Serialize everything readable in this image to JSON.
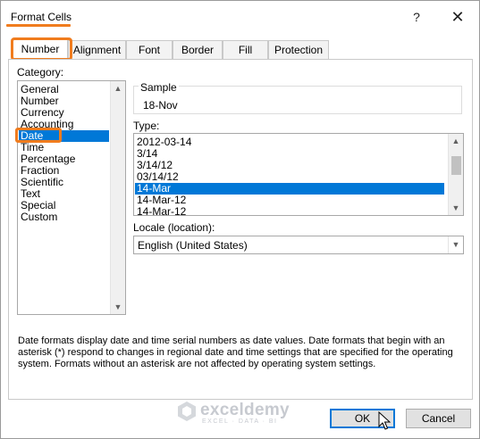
{
  "window": {
    "title": "Format Cells",
    "help_label": "?",
    "close_label": "✕"
  },
  "tabs": [
    {
      "label": "Number",
      "active": true
    },
    {
      "label": "Alignment",
      "active": false
    },
    {
      "label": "Font",
      "active": false
    },
    {
      "label": "Border",
      "active": false
    },
    {
      "label": "Fill",
      "active": false
    },
    {
      "label": "Protection",
      "active": false
    }
  ],
  "category": {
    "label": "Category:",
    "items": [
      "General",
      "Number",
      "Currency",
      "Accounting",
      "Date",
      "Time",
      "Percentage",
      "Fraction",
      "Scientific",
      "Text",
      "Special",
      "Custom"
    ],
    "selected": "Date"
  },
  "sample": {
    "label": "Sample",
    "value": "18-Nov"
  },
  "type": {
    "label": "Type:",
    "items": [
      "2012-03-14",
      "3/14",
      "3/14/12",
      "03/14/12",
      "14-Mar",
      "14-Mar-12",
      "14-Mar-12"
    ],
    "selected": "14-Mar"
  },
  "locale": {
    "label": "Locale (location):",
    "value": "English (United States)"
  },
  "description": "Date formats display date and time serial numbers as date values.  Date formats that begin with an asterisk (*) respond to changes in regional date and time settings that are specified for the operating system. Formats without an asterisk are not affected by operating system settings.",
  "watermark": {
    "name": "exceldemy",
    "tagline": "EXCEL · DATA · BI"
  },
  "buttons": {
    "ok_label": "OK",
    "cancel_label": "Cancel"
  },
  "colors": {
    "highlight": "#f07c1e",
    "selection": "#0078d7"
  }
}
